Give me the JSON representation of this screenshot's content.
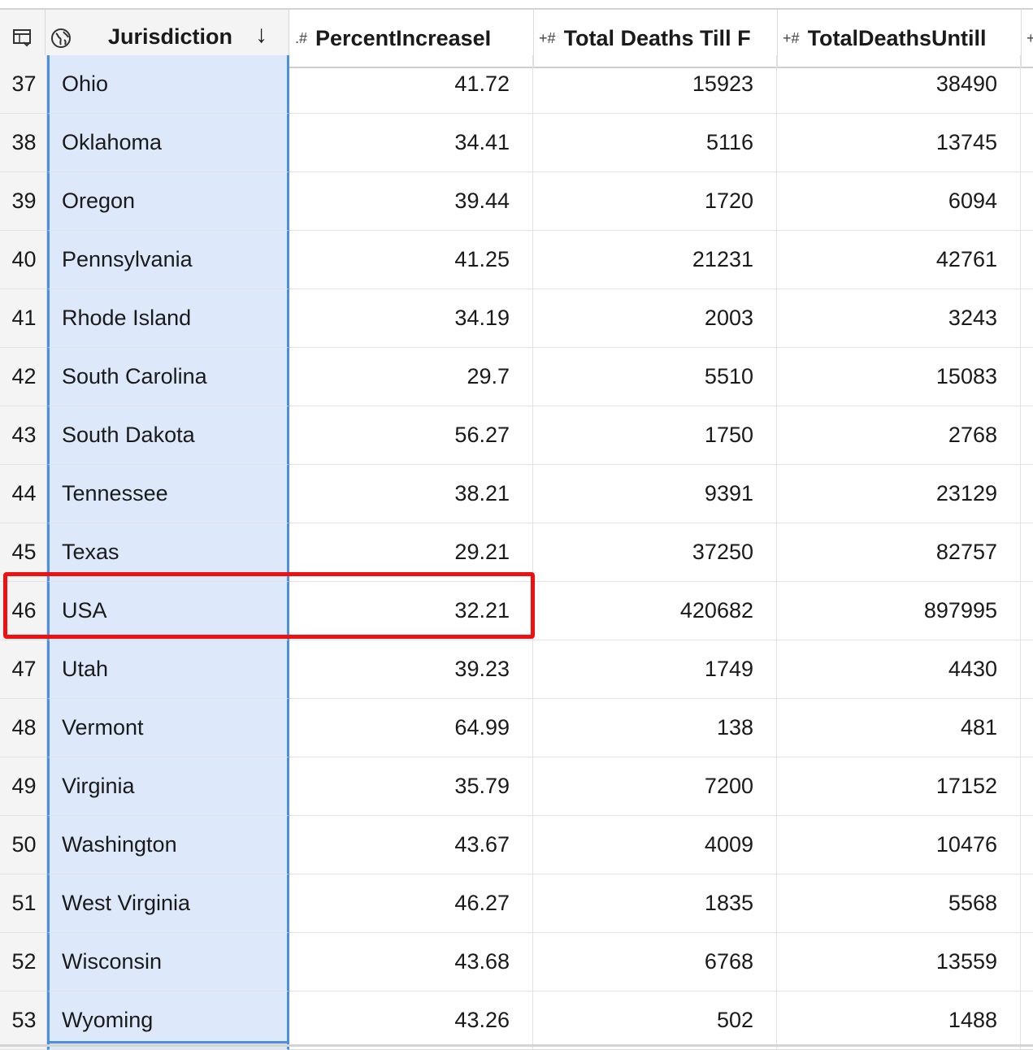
{
  "header": {
    "table_icon": "table-columns-icon",
    "globe_icon": "globe-icon",
    "jurisdiction_label": "Jurisdiction",
    "sort_arrow": "↓",
    "col1_type": ".#",
    "col1_label": "PercentIncreaseI",
    "col2_type": "+#",
    "col2_label": "Total Deaths Till F",
    "col3_type": "+#",
    "col3_label": "TotalDeathsUntill",
    "col4_type": "+"
  },
  "rows": [
    {
      "num": "37",
      "name": "Ohio",
      "pct": "41.72",
      "deaths_till": "15923",
      "deaths_until": "38490"
    },
    {
      "num": "38",
      "name": "Oklahoma",
      "pct": "34.41",
      "deaths_till": "5116",
      "deaths_until": "13745"
    },
    {
      "num": "39",
      "name": "Oregon",
      "pct": "39.44",
      "deaths_till": "1720",
      "deaths_until": "6094"
    },
    {
      "num": "40",
      "name": "Pennsylvania",
      "pct": "41.25",
      "deaths_till": "21231",
      "deaths_until": "42761"
    },
    {
      "num": "41",
      "name": "Rhode Island",
      "pct": "34.19",
      "deaths_till": "2003",
      "deaths_until": "3243"
    },
    {
      "num": "42",
      "name": "South Carolina",
      "pct": "29.7",
      "deaths_till": "5510",
      "deaths_until": "15083"
    },
    {
      "num": "43",
      "name": "South Dakota",
      "pct": "56.27",
      "deaths_till": "1750",
      "deaths_until": "2768"
    },
    {
      "num": "44",
      "name": "Tennessee",
      "pct": "38.21",
      "deaths_till": "9391",
      "deaths_until": "23129"
    },
    {
      "num": "45",
      "name": "Texas",
      "pct": "29.21",
      "deaths_till": "37250",
      "deaths_until": "82757"
    },
    {
      "num": "46",
      "name": "USA",
      "pct": "32.21",
      "deaths_till": "420682",
      "deaths_until": "897995"
    },
    {
      "num": "47",
      "name": "Utah",
      "pct": "39.23",
      "deaths_till": "1749",
      "deaths_until": "4430"
    },
    {
      "num": "48",
      "name": "Vermont",
      "pct": "64.99",
      "deaths_till": "138",
      "deaths_until": "481"
    },
    {
      "num": "49",
      "name": "Virginia",
      "pct": "35.79",
      "deaths_till": "7200",
      "deaths_until": "17152"
    },
    {
      "num": "50",
      "name": "Washington",
      "pct": "43.67",
      "deaths_till": "4009",
      "deaths_until": "10476"
    },
    {
      "num": "51",
      "name": "West Virginia",
      "pct": "46.27",
      "deaths_till": "1835",
      "deaths_until": "5568"
    },
    {
      "num": "52",
      "name": "Wisconsin",
      "pct": "43.68",
      "deaths_till": "6768",
      "deaths_until": "13559"
    },
    {
      "num": "53",
      "name": "Wyoming",
      "pct": "43.26",
      "deaths_till": "502",
      "deaths_until": "1488"
    }
  ],
  "highlighted_row": "46",
  "colors": {
    "selection_fill": "#dde9fb",
    "selection_border": "#4a8fe0",
    "highlight_border": "#ee1111"
  }
}
